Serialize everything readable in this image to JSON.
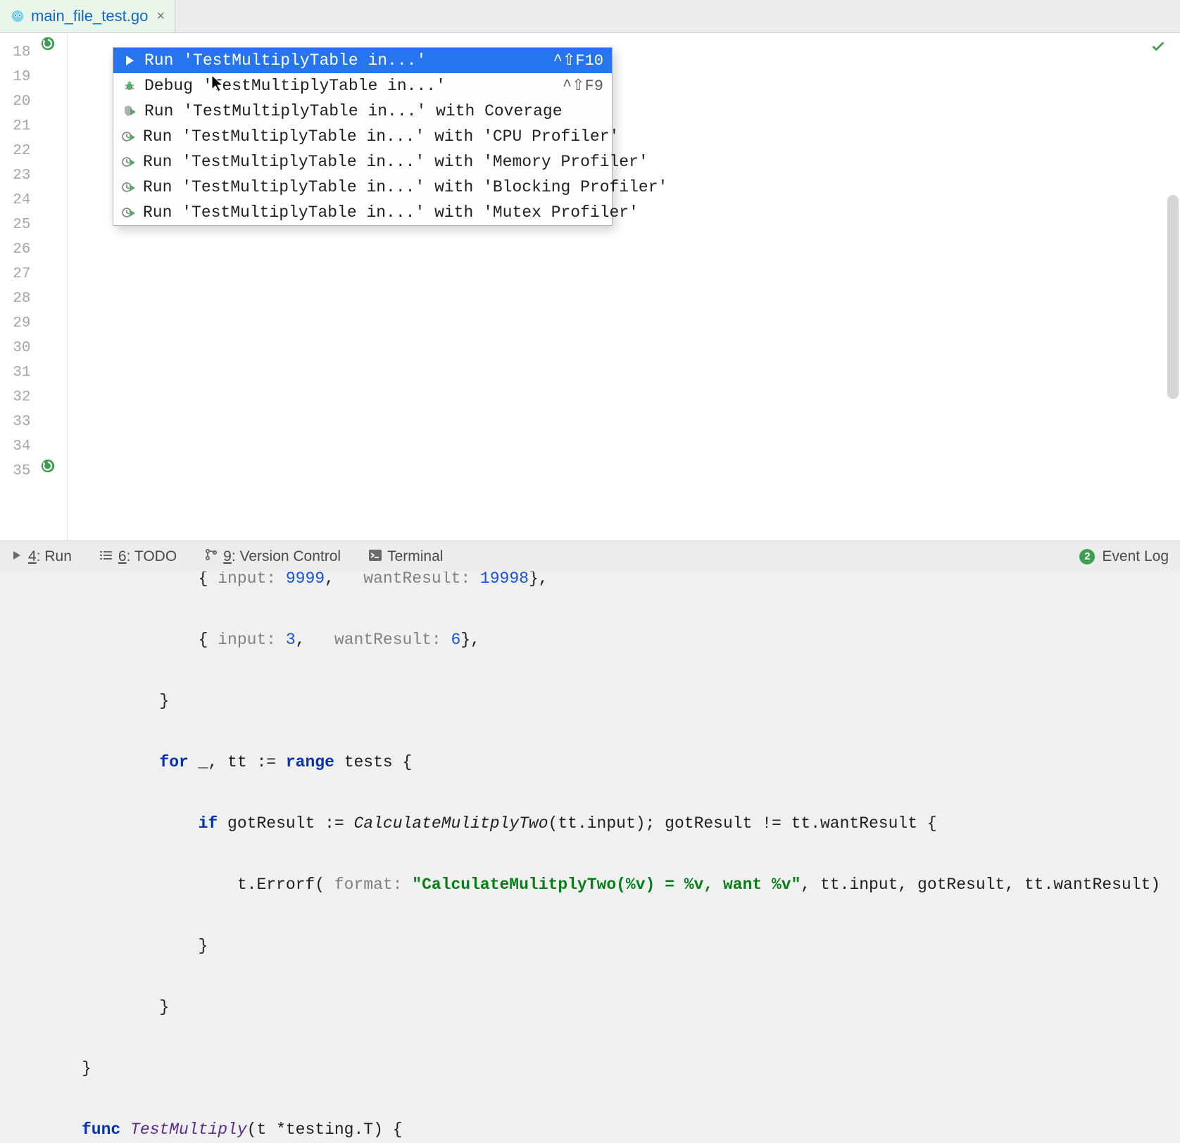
{
  "tab": {
    "filename": "main_file_test.go"
  },
  "gutter": {
    "start": 18,
    "end": 35
  },
  "menu": {
    "items": [
      {
        "icon": "play-green",
        "label": "Run 'TestMultiplyTable in...'",
        "shortcut": "^⇧F10",
        "selected": true
      },
      {
        "icon": "bug-green",
        "label": "Debug 'TestMultiplyTable in...'",
        "shortcut": "^⇧F9"
      },
      {
        "icon": "play-shield",
        "label": "Run 'TestMultiplyTable in...' with Coverage",
        "shortcut": ""
      },
      {
        "icon": "play-clock",
        "label": "Run 'TestMultiplyTable in...' with 'CPU Profiler'",
        "shortcut": ""
      },
      {
        "icon": "play-clock",
        "label": "Run 'TestMultiplyTable in...' with 'Memory Profiler'",
        "shortcut": ""
      },
      {
        "icon": "play-clock",
        "label": "Run 'TestMultiplyTable in...' with 'Blocking Profiler'",
        "shortcut": ""
      },
      {
        "icon": "play-clock",
        "label": "Run 'TestMultiplyTable in...' with 'Mutex Profiler'",
        "shortcut": ""
      }
    ]
  },
  "code": {
    "l26_a": "            { ",
    "l26_b": "input:",
    "l26_c": " 9999",
    "l26_d": ",   ",
    "l26_e": "wantResult:",
    "l26_f": " 19998",
    "l26_g": "},",
    "l27_a": "            { ",
    "l27_b": "input:",
    "l27_c": " 3",
    "l27_d": ",   ",
    "l27_e": "wantResult:",
    "l27_f": " 6",
    "l27_g": "},",
    "l28": "        }",
    "l29_a": "        ",
    "l29_b": "for",
    "l29_c": " _, tt := ",
    "l29_d": "range",
    "l29_e": " tests {",
    "l30_a": "            ",
    "l30_b": "if",
    "l30_c": " gotResult := ",
    "l30_d": "CalculateMulitplyTwo",
    "l30_e": "(tt.input); gotResult != tt.wantResult {",
    "l31_a": "                t.Errorf( ",
    "l31_b": "format:",
    "l31_c": " \"CalculateMulitplyTwo(%v) = %v, want %v\"",
    "l31_d": ", tt.input, gotResult, tt.wantResult)",
    "l32": "            }",
    "l33": "        }",
    "l34": "}",
    "l35_a": "func",
    "l35_b": " TestMultiply",
    "l35_c": "(t *testing.T) {"
  },
  "statusbar": {
    "run": "4: Run",
    "todo": "6: TODO",
    "vcs": "9: Version Control",
    "terminal": "Terminal",
    "eventlog": "Event Log",
    "badge": "2"
  }
}
